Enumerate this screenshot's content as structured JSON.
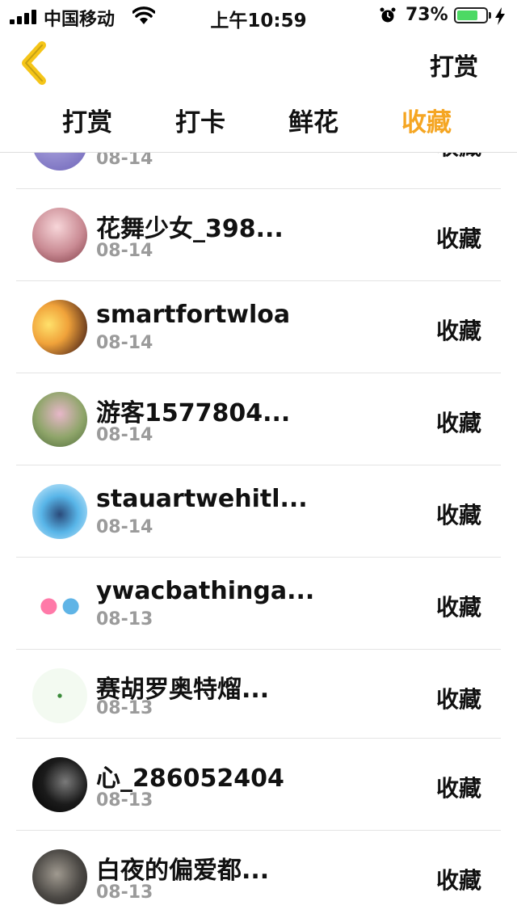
{
  "status_bar": {
    "carrier": "中国移动",
    "time": "上午10:59",
    "battery_percent": "73%",
    "battery_level": 0.73,
    "battery_color": "#4cd964"
  },
  "nav": {
    "back_icon": "chevron-left-icon",
    "back_icon_color": "#f5c518",
    "action_label": "打赏"
  },
  "tabs": [
    {
      "label": "打赏",
      "active": false
    },
    {
      "label": "打卡",
      "active": false
    },
    {
      "label": "鲜花",
      "active": false
    },
    {
      "label": "收藏",
      "active": true
    }
  ],
  "accent_color": "#f5a623",
  "list": {
    "partial_top": {
      "date": "08-14",
      "action": "收藏"
    },
    "rows": [
      {
        "name": "花舞少女_398...",
        "date": "08-14",
        "action": "收藏"
      },
      {
        "name": "smartfortwloa",
        "date": "08-14",
        "action": "收藏"
      },
      {
        "name": "游客1577804...",
        "date": "08-14",
        "action": "收藏"
      },
      {
        "name": "stauartwehitl...",
        "date": "08-14",
        "action": "收藏"
      },
      {
        "name": "ywacbathinga...",
        "date": "08-13",
        "action": "收藏"
      },
      {
        "name": "赛胡罗奥特熘...",
        "date": "08-13",
        "action": "收藏"
      },
      {
        "name": "心_286052404",
        "date": "08-13",
        "action": "收藏"
      },
      {
        "name": "白夜的偏爱都...",
        "date": "08-13",
        "action": "收藏"
      }
    ]
  }
}
